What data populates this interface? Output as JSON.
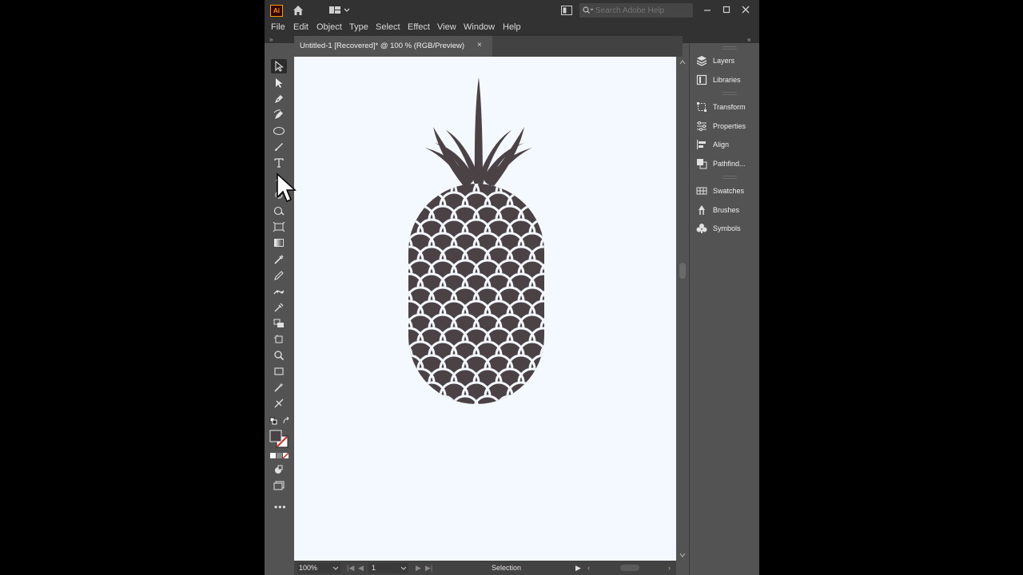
{
  "app": {
    "logo": "Ai",
    "search_placeholder": "Search Adobe Help"
  },
  "menu": [
    "File",
    "Edit",
    "Object",
    "Type",
    "Select",
    "Effect",
    "View",
    "Window",
    "Help"
  ],
  "document": {
    "tab_title": "Untitled-1 [Recovered]* @ 100 % (RGB/Preview)",
    "tab_close": "×"
  },
  "status": {
    "zoom": "100%",
    "artboard": "1",
    "tool": "Selection"
  },
  "panels": {
    "group1": [
      {
        "label": "Layers",
        "icon": "layers-icon"
      },
      {
        "label": "Libraries",
        "icon": "libraries-icon"
      }
    ],
    "group2": [
      {
        "label": "Transform",
        "icon": "transform-icon"
      },
      {
        "label": "Properties",
        "icon": "properties-icon"
      },
      {
        "label": "Align",
        "icon": "align-icon"
      },
      {
        "label": "Pathfind...",
        "icon": "pathfinder-icon"
      }
    ],
    "group3": [
      {
        "label": "Swatches",
        "icon": "swatches-icon"
      },
      {
        "label": "Brushes",
        "icon": "brushes-icon"
      },
      {
        "label": "Symbols",
        "icon": "symbols-icon"
      }
    ]
  },
  "artwork": {
    "subject": "pineapple",
    "fill_color": "#4a4245",
    "background_color": "#f4f8ff"
  },
  "colors": {
    "ui_dark": "#323232",
    "ui_mid": "#535353",
    "accent": "#ff9a00"
  }
}
